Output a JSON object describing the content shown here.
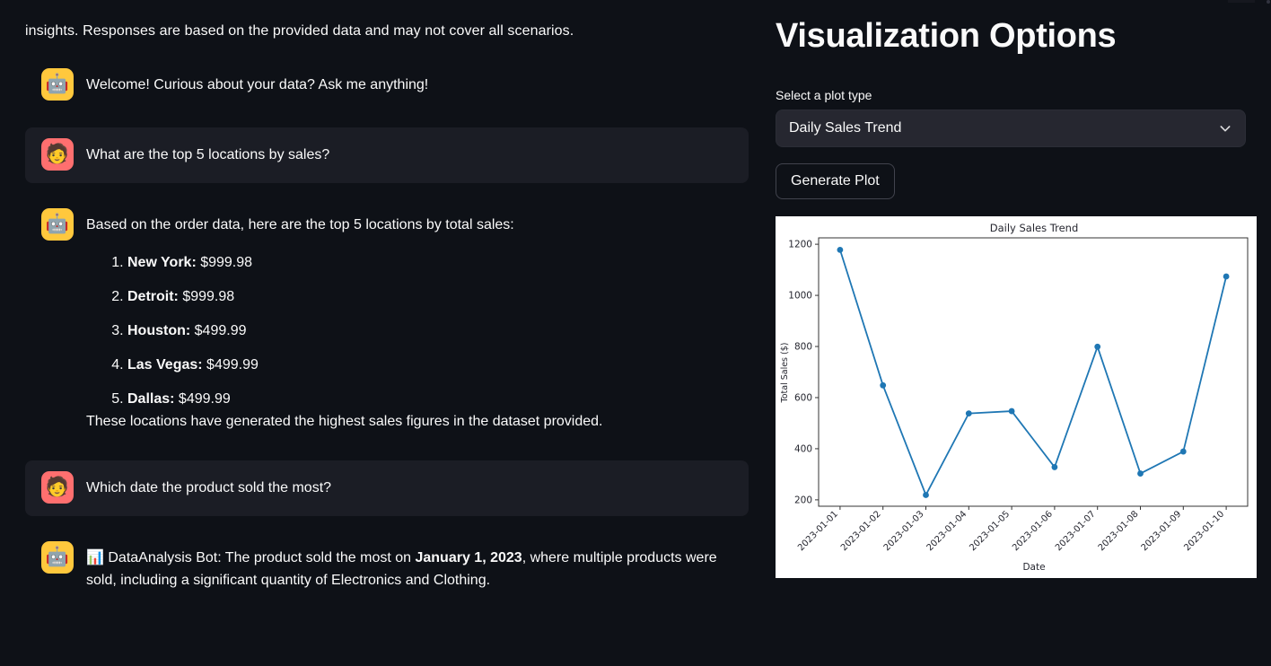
{
  "chat": {
    "intro_line": "insights. Responses are based on the provided data and may not cover all scenarios.",
    "messages": [
      {
        "role": "assistant",
        "avatar_icon": "robot-icon",
        "avatar_glyph": "🤖",
        "text": "Welcome! Curious about your data? Ask me anything!"
      },
      {
        "role": "user",
        "avatar_icon": "person-icon",
        "avatar_glyph": "🧑",
        "text": "What are the top 5 locations by sales?"
      },
      {
        "role": "assistant",
        "avatar_icon": "robot-icon",
        "avatar_glyph": "🤖",
        "intro": "Based on the order data, here are the top 5 locations by total sales:",
        "list": [
          {
            "name": "New York:",
            "value": " $999.98"
          },
          {
            "name": "Detroit:",
            "value": " $999.98"
          },
          {
            "name": "Houston:",
            "value": " $499.99"
          },
          {
            "name": "Las Vegas:",
            "value": " $499.99"
          },
          {
            "name": "Dallas:",
            "value": " $499.99"
          }
        ],
        "outro": "These locations have generated the highest sales figures in the dataset provided."
      },
      {
        "role": "user",
        "avatar_icon": "person-icon",
        "avatar_glyph": "🧑",
        "text": "Which date the product sold the most?"
      },
      {
        "role": "assistant",
        "avatar_icon": "robot-icon",
        "avatar_glyph": "🤖",
        "inline_emoji": "📊",
        "prefix": " DataAnalysis Bot: The product sold the most on ",
        "bold": "January 1, 2023",
        "suffix": ", where multiple products were sold, including a significant quantity of Electronics and Clothing."
      }
    ]
  },
  "options": {
    "title": "Visualization Options",
    "plot_type_label": "Select a plot type",
    "plot_type_value": "Daily Sales Trend",
    "plot_type_options": [
      "Daily Sales Trend"
    ],
    "generate_button": "Generate Plot",
    "chevron_icon": "chevron-down-icon"
  },
  "colors": {
    "page_bg": "#0e1117",
    "user_bubble_bg": "#1b1d25",
    "bot_avatar": "#ffc83d",
    "user_avatar": "#ff6f6f",
    "select_bg": "#262730",
    "line": "#1f77b4",
    "text": "#fafafa"
  },
  "chart_data": {
    "type": "line",
    "title": "Daily Sales Trend",
    "xlabel": "Date",
    "ylabel": "Total Sales ($)",
    "grid": false,
    "legend": "none",
    "line_color": "#1f77b4",
    "marker": "circle",
    "categories": [
      "2023-01-01",
      "2023-01-02",
      "2023-01-03",
      "2023-01-04",
      "2023-01-05",
      "2023-01-06",
      "2023-01-07",
      "2023-01-08",
      "2023-01-09",
      "2023-01-10"
    ],
    "values": [
      1178,
      648,
      219,
      538,
      547,
      328,
      799,
      303,
      389,
      1074
    ],
    "x": [
      0,
      1,
      2,
      3,
      4,
      5,
      6,
      7,
      8,
      9
    ],
    "ylim": [
      175,
      1225
    ],
    "yticks": [
      200,
      400,
      600,
      800,
      1000,
      1200
    ],
    "xtick_rotation": -45
  }
}
